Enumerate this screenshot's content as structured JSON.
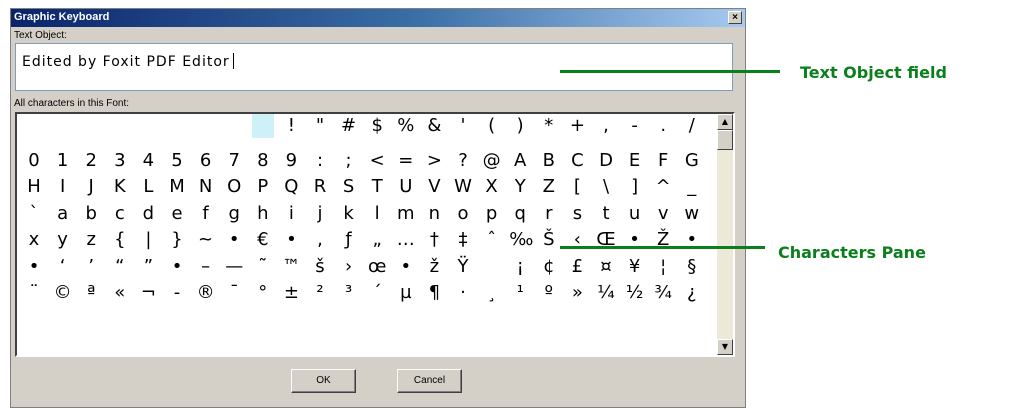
{
  "window": {
    "title": "Graphic Keyboard",
    "close_symbol": "×"
  },
  "text_object": {
    "label": "Text Object:",
    "value": "Edited by Foxit PDF Editor"
  },
  "characters": {
    "label": "All characters in this Font:",
    "selected_index": 0,
    "rows": [
      [
        " ",
        "!",
        "\"",
        "#",
        "$",
        "%",
        "&",
        "'",
        "(",
        ")",
        "*",
        "+",
        ",",
        "-",
        ".",
        "/"
      ],
      [
        "0",
        "1",
        "2",
        "3",
        "4",
        "5",
        "6",
        "7",
        "8",
        "9",
        ":",
        ";",
        "<",
        "=",
        ">",
        "?",
        "@",
        "A",
        "B",
        "C",
        "D",
        "E",
        "F",
        "G"
      ],
      [
        "H",
        "I",
        "J",
        "K",
        "L",
        "M",
        "N",
        "O",
        "P",
        "Q",
        "R",
        "S",
        "T",
        "U",
        "V",
        "W",
        "X",
        "Y",
        "Z",
        "[",
        "\\",
        "]",
        "^",
        "_"
      ],
      [
        "`",
        "a",
        "b",
        "c",
        "d",
        "e",
        "f",
        "g",
        "h",
        "i",
        "j",
        "k",
        "l",
        "m",
        "n",
        "o",
        "p",
        "q",
        "r",
        "s",
        "t",
        "u",
        "v",
        "w"
      ],
      [
        "x",
        "y",
        "z",
        "{",
        "|",
        "}",
        "~",
        "•",
        "€",
        "•",
        ",",
        "ƒ",
        "„",
        "…",
        "†",
        "‡",
        "ˆ",
        "‰",
        "Š",
        "‹",
        "Œ",
        "•",
        "Ž",
        "•"
      ],
      [
        "•",
        "‘",
        "’",
        "“",
        "”",
        "•",
        "–",
        "—",
        "˜",
        "™",
        "š",
        "›",
        "œ",
        "•",
        "ž",
        "Ÿ",
        " ",
        "¡",
        "¢",
        "£",
        "¤",
        "¥",
        "¦",
        "§"
      ],
      [
        "¨",
        "©",
        "ª",
        "«",
        "¬",
        "-",
        "®",
        "¯",
        "°",
        "±",
        "²",
        "³",
        "´",
        "µ",
        "¶",
        "·",
        "¸",
        "¹",
        "º",
        "»",
        "¼",
        "½",
        "¾",
        "¿"
      ]
    ]
  },
  "buttons": {
    "ok": "OK",
    "cancel": "Cancel"
  },
  "callouts": {
    "text_object": "Text Object field",
    "characters": "Characters Pane"
  },
  "colors": {
    "callout": "#0a7f1c",
    "selection": "#cdf1f6",
    "title_start": "#0a246a"
  }
}
